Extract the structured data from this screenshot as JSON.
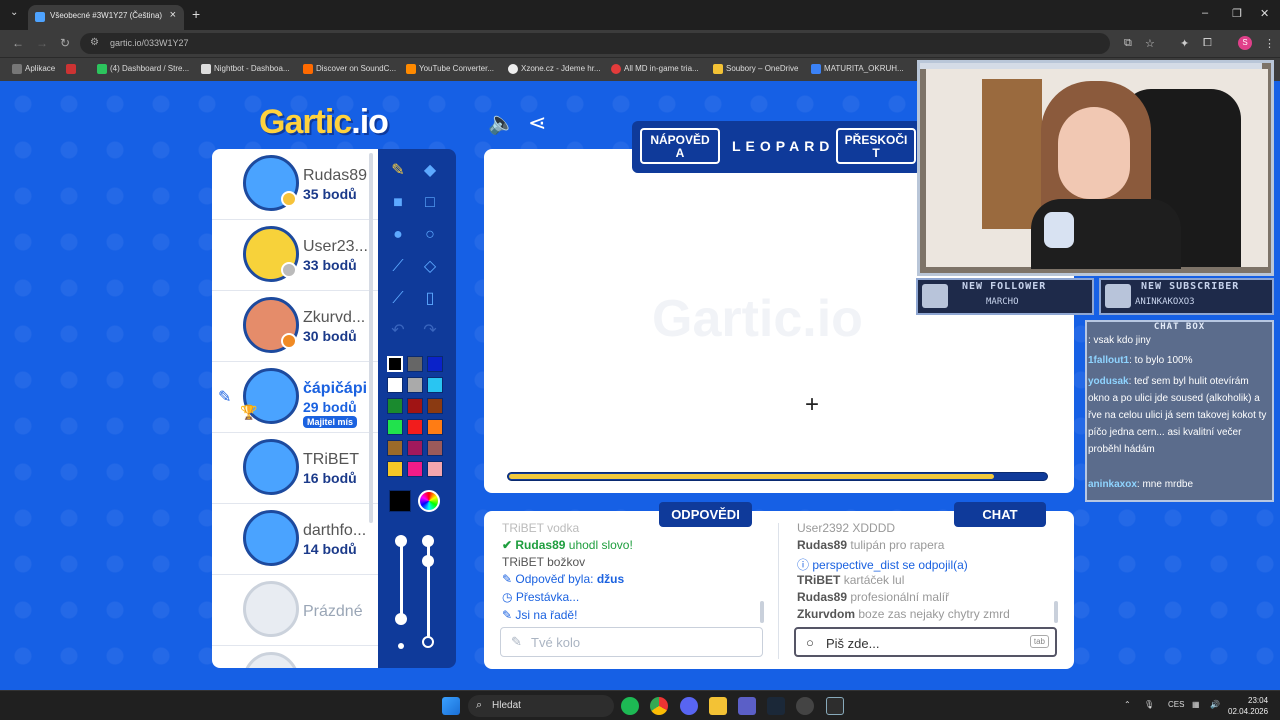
{
  "browser": {
    "tab_title": "Všeobecné #3W1Y27 (Čeština)",
    "url": "gartic.io/033W1Y27",
    "bookmarks": [
      {
        "label": "Aplikace",
        "color": "#888888"
      },
      {
        "label": "(4) Dashboard / Stre...",
        "color": "#2cc45d"
      },
      {
        "label": "Nightbot - Dashboa...",
        "color": "#dddddd"
      },
      {
        "label": "Discover on SoundC...",
        "color": "#ff6a00"
      },
      {
        "label": "YouTube Converter...",
        "color": "#ff8a00"
      },
      {
        "label": "Xzone.cz - Jdeme hr...",
        "color": "#eeeeee"
      },
      {
        "label": "All MD in-game tria...",
        "color": "#e33b3b"
      },
      {
        "label": "Soubory – OneDrive",
        "color": "#f3c235"
      },
      {
        "label": "MATURITA_OKRUH...",
        "color": "#3b82f6"
      }
    ]
  },
  "game": {
    "logo": "Gartic",
    "logo_tld": ".io",
    "players": [
      {
        "name": "Rudas89",
        "points": "35 bodů",
        "avatar_color": "#4aa3ff",
        "status_color": "#f6c33a"
      },
      {
        "name": "User23...",
        "points": "33 bodů",
        "avatar_color": "#f7d23a",
        "status_color": "#bbbbbb"
      },
      {
        "name": "Zkurvd...",
        "points": "30 bodů",
        "avatar_color": "#e58c6a",
        "status_color": "#f08a24"
      },
      {
        "name": "čápičápi",
        "points": "29 bodů",
        "avatar_color": "#4aa3ff",
        "badge": "Majitel mís"
      },
      {
        "name": "TRiBET",
        "points": "16 bodů",
        "avatar_color": "#4aa3ff"
      },
      {
        "name": "darthfo...",
        "points": "14 bodů",
        "avatar_color": "#4aa3ff"
      }
    ],
    "empty_slot": "Prázdné",
    "hint_button": "NÁPOVĚDA",
    "skip_button": "PŘESKOČIT",
    "word": "LEOPARD",
    "canvas_watermark": "Gartic.io",
    "timer_fraction": 0.9,
    "answers_header": "ODPOVĚDI",
    "chat_header": "CHAT",
    "answers": {
      "l0": "TRiBET vodka",
      "l1_name": "Rudas89",
      "l1_text": "uhodl slovo!",
      "l2": "TRiBET božkov",
      "l3_text": "Odpověď byla:",
      "l3_word": "džus",
      "l4": "Přestávka...",
      "l5": "Jsi na řadě!"
    },
    "answer_placeholder": "Tvé kolo",
    "chat": {
      "l0": "User2392 XDDDD",
      "l1_name": "Rudas89",
      "l1_text": "tulipán pro rapera",
      "l2_name": "perspective_dist",
      "l2_text": "se odpojil(a)",
      "l3_name": "TRiBET",
      "l3_text": "kartáček lul",
      "l4_name": "Rudas89",
      "l4_text": "profesionální malíř",
      "l5_name": "Zkurvdom",
      "l5_text": "boze zas nejaky chytry zmrd"
    },
    "chat_placeholder": "Piš zde...",
    "chat_key_hint": "tab",
    "colors": [
      "#000000",
      "#666666",
      "#0a22c9",
      "#ffffff",
      "#aaaaaa",
      "#29c5f2",
      "#1a8a2e",
      "#a01414",
      "#8a3a12",
      "#21e24d",
      "#f21c1c",
      "#ff7c14",
      "#9c6a2a",
      "#a0195c",
      "#9c5a5a",
      "#f6c726",
      "#f01c88",
      "#f4a6ae"
    ],
    "selected_color": "#000000"
  },
  "overlay": {
    "follower_title": "NEW FOLLOWER",
    "follower_name": "MARCHO",
    "subscriber_title": "NEW SUBSCRIBER",
    "subscriber_name": "ANINKAKOXO3",
    "chatbox_title": "CHAT BOX",
    "messages": [
      {
        "user": "",
        "text": ": vsak kdo jiny"
      },
      {
        "user": "1fallout1",
        "text": ": to bylo 100%"
      },
      {
        "user": "yodusak",
        "text": ": teď sem byl hulit otevírám okno a po ulici jde soused (alkoholik) a řve na celou ulici já sem takovej kokot ty píčo jedna cern... asi kvalitní večer proběhl hádám"
      },
      {
        "user": "aninkaxox",
        "text": ": mne mrdbe"
      }
    ]
  },
  "taskbar": {
    "search": "Hledat",
    "lang": "CES",
    "time": "23:04",
    "date": "02.04.2026"
  }
}
